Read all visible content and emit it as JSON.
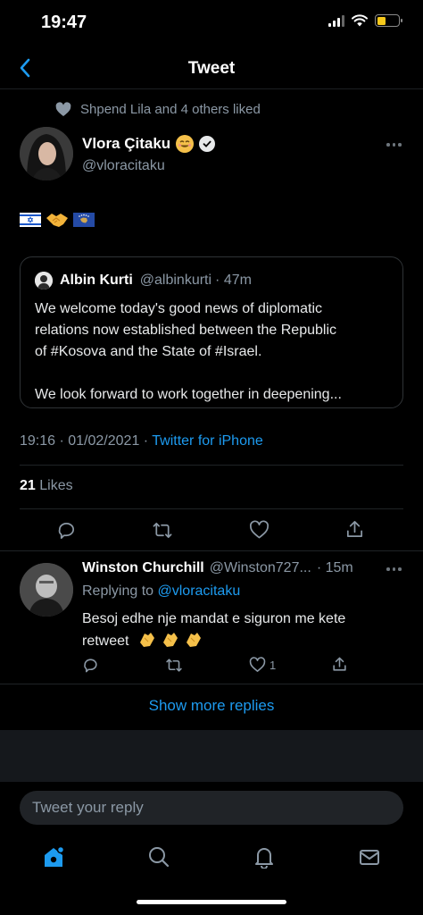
{
  "status_bar": {
    "time": "19:47"
  },
  "nav": {
    "title": "Tweet"
  },
  "social_context": {
    "text": "Shpend Lila and 4 others liked"
  },
  "tweet": {
    "author_name": "Vlora Çitaku",
    "author_handle": "@vloracitaku",
    "timestamp": "19:16 · 01/02/2021 · ",
    "source": "Twitter for iPhone",
    "likes_count": "21",
    "likes_label": " Likes"
  },
  "quoted_tweet": {
    "author_name": "Albin Kurti",
    "author_handle": "@albinkurti",
    "time": "· 47m",
    "lines": [
      "We welcome today's good news of diplomatic",
      "relations now established between the Republic",
      "of #Kosova and the State of #Israel.",
      "",
      "We look forward to work together in deepening..."
    ]
  },
  "reply": {
    "author_name": "Winston Churchill",
    "author_handle": "@Winston727...",
    "time": "· 15m",
    "replying_label": "Replying to ",
    "replying_handle": "@vloracitaku",
    "text_line1": "Besoj edhe nje mandat e siguron me kete",
    "text_line2": "retweet",
    "like_count": "1"
  },
  "show_more": {
    "label": "Show more replies"
  },
  "reply_box": {
    "placeholder": "Tweet your reply"
  },
  "colors": {
    "accent": "#1d9bf0",
    "background": "#000000",
    "secondary_text": "#8b98a5"
  },
  "icons": [
    "back-chevron-icon",
    "heart-icon",
    "more-dots-icon",
    "reply-icon",
    "retweet-icon",
    "like-icon",
    "share-icon",
    "home-icon",
    "search-icon",
    "notifications-icon",
    "messages-icon"
  ]
}
